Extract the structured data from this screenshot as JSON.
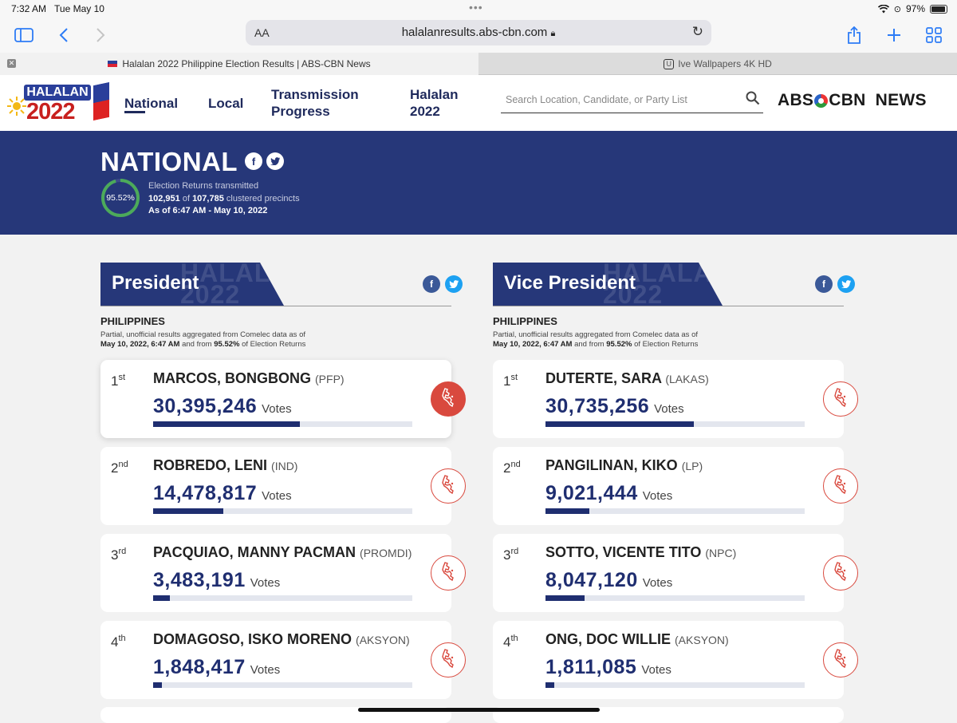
{
  "status": {
    "time": "7:32 AM",
    "date": "Tue May 10",
    "battery": "97%"
  },
  "browser": {
    "aa_label": "AA",
    "url": "halalanresults.abs-cbn.com",
    "tabs": [
      {
        "title": "Halalan 2022 Philippine Election Results | ABS-CBN News",
        "active": true
      },
      {
        "title": "Ive Wallpapers 4K HD",
        "icon_letter": "U",
        "active": false
      }
    ]
  },
  "site": {
    "logo": {
      "text_top": "HALALAN",
      "text_bottom": "2022"
    },
    "nav": [
      {
        "label": "National"
      },
      {
        "label": "Local"
      },
      {
        "label": "Transmission Progress"
      },
      {
        "label": "Halalan 2022"
      }
    ],
    "search_placeholder": "Search Location, Candidate, or Party List",
    "brand": {
      "abs": "ABS",
      "cbn": "CBN",
      "news": "NEWS"
    }
  },
  "banner": {
    "title": "NATIONAL",
    "percent": "95.52%",
    "percent_value": 95.52,
    "line1": "Election Returns transmitted",
    "transmitted": "102,951",
    "of": " of ",
    "total": "107,785",
    "precincts": " clustered precincts",
    "as_of": "As of 6:47 AM - May 10, 2022"
  },
  "panels": [
    {
      "title": "President",
      "watermark": "HALALAN 2022",
      "region": "PHILIPPINES",
      "note_line1": "Partial, unofficial results aggregated from Comelec data as of",
      "note_date": "May 10, 2022, 6:47 AM",
      "note_mid": " and from ",
      "note_pct": "95.52%",
      "note_end": " of Election Returns",
      "votes_label": "Votes",
      "candidates": [
        {
          "rank": "1",
          "suffix": "st",
          "name": "MARCOS, BONGBONG",
          "party": "(PFP)",
          "votes": "30,395,246",
          "share": 0.565
        },
        {
          "rank": "2",
          "suffix": "nd",
          "name": "ROBREDO, LENI",
          "party": "(IND)",
          "votes": "14,478,817",
          "share": 0.27
        },
        {
          "rank": "3",
          "suffix": "rd",
          "name": "PACQUIAO, MANNY PACMAN",
          "party": "(PROMDI)",
          "votes": "3,483,191",
          "share": 0.065
        },
        {
          "rank": "4",
          "suffix": "th",
          "name": "DOMAGOSO, ISKO MORENO",
          "party": "(AKSYON)",
          "votes": "1,848,417",
          "share": 0.034
        }
      ]
    },
    {
      "title": "Vice President",
      "watermark": "HALALAN 2022",
      "region": "PHILIPPINES",
      "note_line1": "Partial, unofficial results aggregated from Comelec data as of",
      "note_date": "May 10, 2022, 6:47 AM",
      "note_mid": " and from ",
      "note_pct": "95.52%",
      "note_end": " of Election Returns",
      "votes_label": "Votes",
      "candidates": [
        {
          "rank": "1",
          "suffix": "st",
          "name": "DUTERTE, SARA",
          "party": "(LAKAS)",
          "votes": "30,735,256",
          "share": 0.572
        },
        {
          "rank": "2",
          "suffix": "nd",
          "name": "PANGILINAN, KIKO",
          "party": "(LP)",
          "votes": "9,021,444",
          "share": 0.168
        },
        {
          "rank": "3",
          "suffix": "rd",
          "name": "SOTTO, VICENTE TITO",
          "party": "(NPC)",
          "votes": "8,047,120",
          "share": 0.15
        },
        {
          "rank": "4",
          "suffix": "th",
          "name": "ONG, DOC WILLIE",
          "party": "(AKSYON)",
          "votes": "1,811,085",
          "share": 0.034
        }
      ]
    }
  ],
  "colors": {
    "navy": "#263779",
    "accent_red": "#d9493e",
    "bar_fill": "#1f2e70"
  }
}
